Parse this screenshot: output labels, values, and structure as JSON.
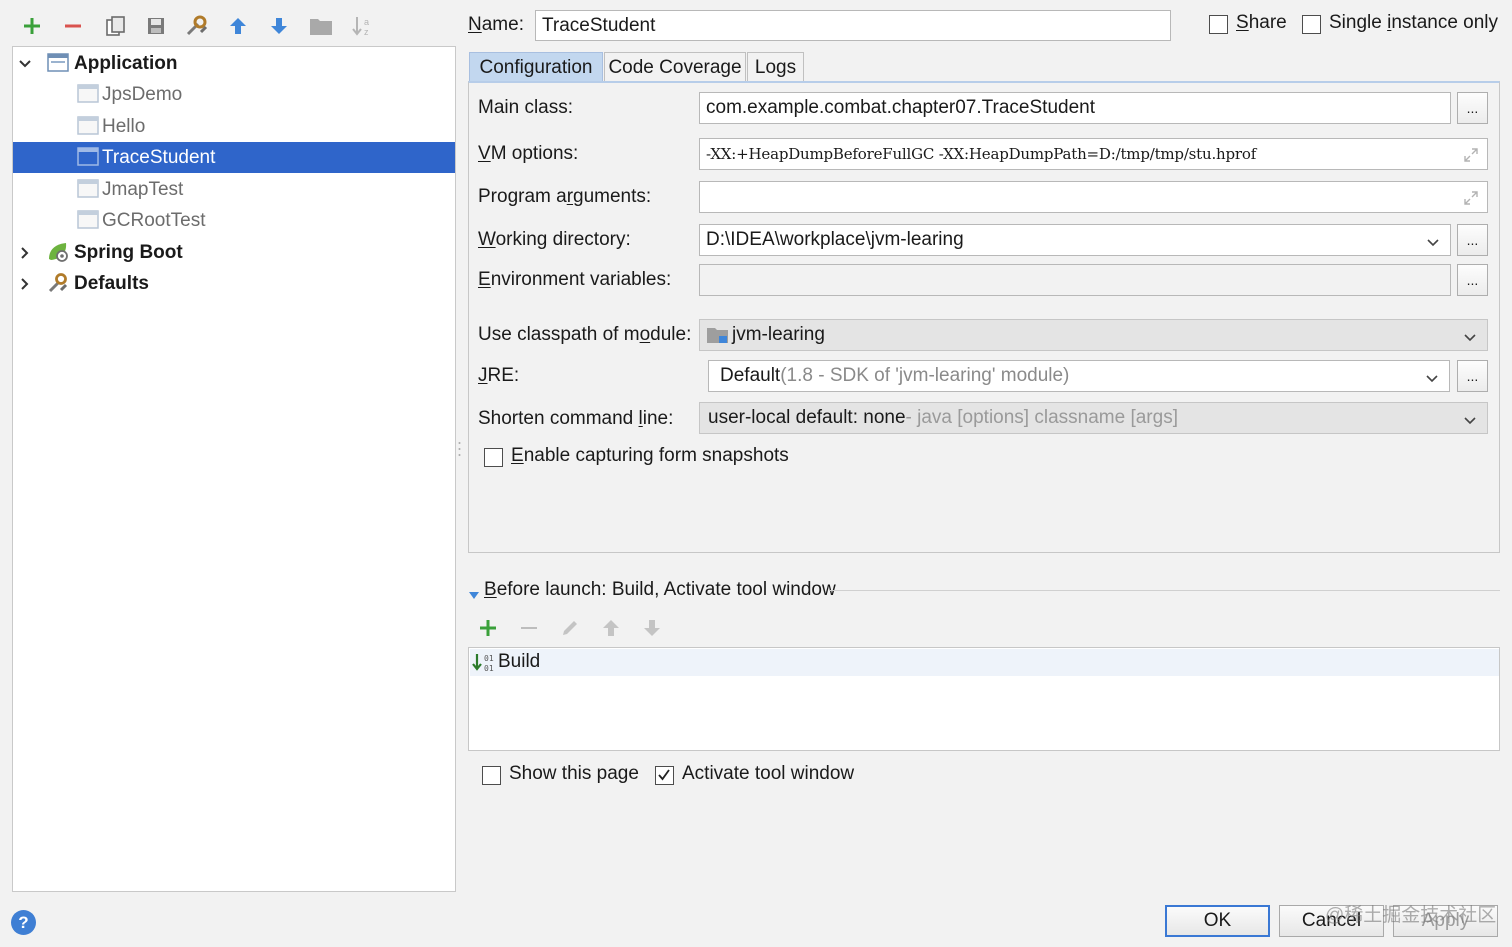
{
  "toolbar": {
    "icons": [
      "add-icon",
      "remove-icon",
      "copy-icon",
      "save-icon",
      "edit-defaults-icon",
      "move-up-icon",
      "move-down-icon",
      "folder-icon",
      "sort-icon"
    ]
  },
  "tree": {
    "items": [
      {
        "label": "Application",
        "expanded": true
      },
      {
        "label": "JpsDemo"
      },
      {
        "label": "Hello"
      },
      {
        "label": "TraceStudent",
        "selected": true
      },
      {
        "label": "JmapTest"
      },
      {
        "label": "GCRootTest"
      },
      {
        "label": "Spring Boot",
        "expanded": false
      },
      {
        "label": "Defaults",
        "expanded": false
      }
    ]
  },
  "header": {
    "name_label_mnemonic": "N",
    "name_label_rest": "ame:",
    "name_value": "TraceStudent",
    "share_label_mnemonic": "S",
    "share_label_rest": "hare",
    "share_checked": false,
    "single_pre": "Single ",
    "single_mnemonic": "i",
    "single_rest": "nstance only",
    "single_checked": false
  },
  "tabs": [
    {
      "label": "Configuration",
      "active": true
    },
    {
      "label": "Code Coverage"
    },
    {
      "label": "Logs"
    }
  ],
  "form": {
    "main_class_label": "Main class:",
    "main_class_value": "com.example.combat.chapter07.TraceStudent",
    "vm_options_label_mnemonic": "V",
    "vm_options_label_rest": "M options:",
    "vm_options_value": "-XX:+HeapDumpBeforeFullGC -XX:HeapDumpPath=D:/tmp/tmp/stu.hprof",
    "program_args_pre": "Program a",
    "program_args_mnemonic": "r",
    "program_args_rest": "guments:",
    "program_args_value": "",
    "working_dir_mnemonic": "W",
    "working_dir_rest": "orking directory:",
    "working_dir_value": "D:\\IDEA\\workplace\\jvm-learing",
    "env_vars_mnemonic": "E",
    "env_vars_rest": "nvironment variables:",
    "env_vars_value": "",
    "classpath_pre": "Use classpath of m",
    "classpath_mnemonic": "o",
    "classpath_rest": "dule:",
    "classpath_value": "jvm-learing",
    "jre_mnemonic": "J",
    "jre_rest": "RE:",
    "jre_value_main": "Default",
    "jre_value_hint": " (1.8 - SDK of 'jvm-learing' module)",
    "shorten_pre": "Shorten command ",
    "shorten_mnemonic": "l",
    "shorten_rest": "ine:",
    "shorten_value_main": "user-local default: none",
    "shorten_value_hint": " - java [options] classname [args]",
    "snapshots_mnemonic": "E",
    "snapshots_rest": "nable capturing form snapshots",
    "snapshots_checked": false,
    "browse_label": "..."
  },
  "before_launch": {
    "title_mnemonic": "B",
    "title_rest": "efore launch: Build, Activate tool window",
    "items": [
      {
        "label": "Build"
      }
    ],
    "show_page_label": "Show this page",
    "show_page_checked": false,
    "activate_label": "Activate tool window",
    "activate_checked": true
  },
  "footer": {
    "ok_label": "OK",
    "cancel_label": "Cancel",
    "apply_label": "Apply",
    "help_label": "?",
    "watermark": "@稀土掘金技术社区"
  },
  "colors": {
    "selection": "#2f65ca",
    "tab_active": "#c2d7ef",
    "add_green": "#3aa03a",
    "remove_red": "#d9534f",
    "arrow_blue": "#3f86d9"
  }
}
